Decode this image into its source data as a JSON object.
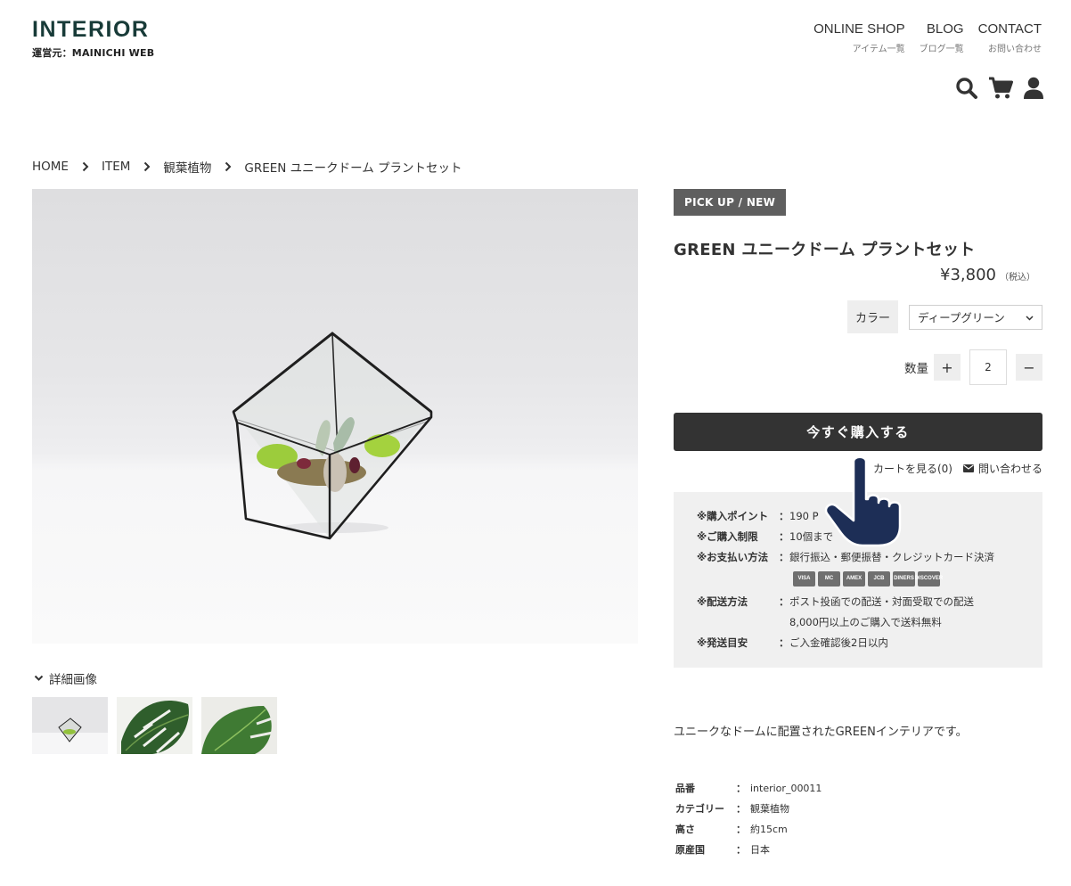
{
  "header": {
    "logo_title": "INTERIOR",
    "logo_subtitle": "運営元：MAINICHI WEB",
    "nav": [
      {
        "label": "ONLINE SHOP",
        "sub": "アイテム一覧"
      },
      {
        "label": "BLOG",
        "sub": "ブログ一覧"
      },
      {
        "label": "CONTACT",
        "sub": "お問い合わせ"
      }
    ],
    "icons": [
      "search-icon",
      "cart-icon",
      "user-icon"
    ]
  },
  "breadcrumb": [
    "HOME",
    "ITEM",
    "観葉植物",
    "GREEN ユニークドーム プラントセット"
  ],
  "gallery": {
    "toggle_label": "詳細画像",
    "thumbnails": [
      "terrarium",
      "monstera-leaf-1",
      "monstera-leaf-2"
    ]
  },
  "product": {
    "badge": "PICK UP / NEW",
    "title": "GREEN ユニークドーム プラントセット",
    "price": "¥3,800",
    "tax_note": "（税込）",
    "color_label": "カラー",
    "color_value": "ディープグリーン",
    "quantity_label": "数量",
    "quantity_value": "2",
    "plus": "+",
    "minus": "−",
    "buy_button": "今すぐ購入する",
    "cart_link": "カートを見る(0)",
    "inquiry_link": "問い合わせる"
  },
  "info": {
    "points_key": "※購入ポイント",
    "points_val": "190 P",
    "limit_key": "※ご購入制限",
    "limit_val": "10個まで",
    "payment_key": "※お支払い方法",
    "payment_val": "銀行振込・郵便振替・クレジットカード決済",
    "cards": [
      "VISA",
      "MC",
      "AMEX",
      "JCB",
      "DINERS",
      "DISCOVER"
    ],
    "shipping_key": "※配送方法",
    "shipping_val_1": "ポスト投函での配送・対面受取での配送",
    "shipping_val_2": "8,000円以上のご購入で送料無料",
    "eta_key": "※発送目安",
    "eta_val": "ご入金確認後2日以内",
    "colon": "："
  },
  "description": "ユニークなドームに配置されたGREENインテリアです。",
  "spec": [
    {
      "key": "品番",
      "value": "interior_00011"
    },
    {
      "key": "カテゴリー",
      "value": "観葉植物"
    },
    {
      "key": "高さ",
      "value": "約15cm"
    },
    {
      "key": "原産国",
      "value": "日本"
    }
  ],
  "colors": {
    "logo": "#183b38",
    "button": "#333333",
    "badge": "#5f5f5f",
    "info_bg": "#f0f0f0",
    "cursor": "#1d2e56"
  }
}
